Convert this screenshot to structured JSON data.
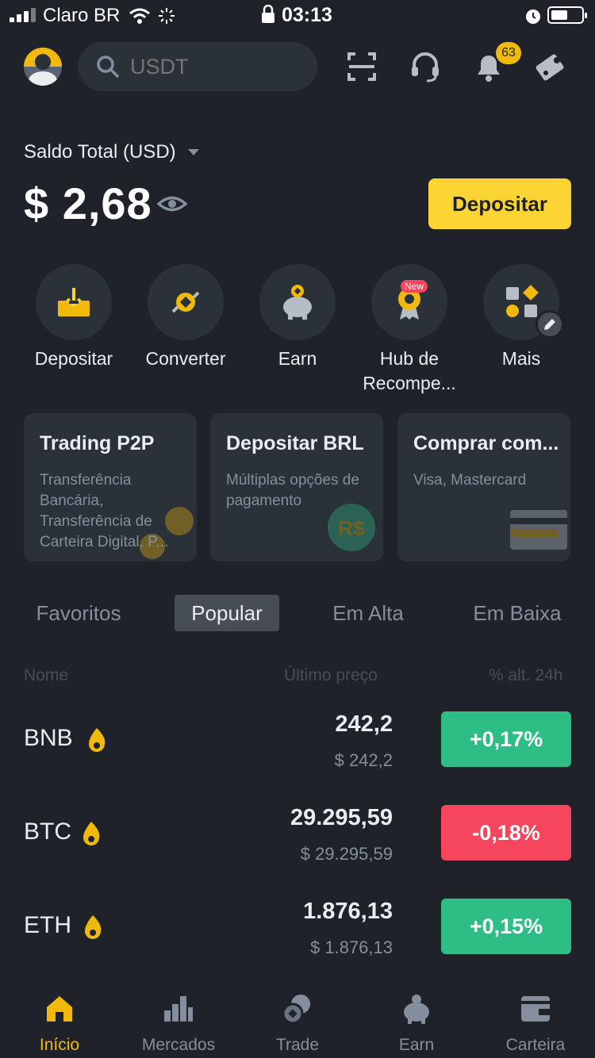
{
  "status_bar": {
    "carrier": "Claro BR",
    "time": "03:13"
  },
  "header": {
    "search_placeholder": "USDT",
    "notification_count": "63"
  },
  "balance": {
    "label": "Saldo Total (USD)",
    "value": "$ 2,68",
    "deposit_label": "Depositar"
  },
  "quick_actions": [
    {
      "label": "Depositar",
      "icon": "deposit-icon"
    },
    {
      "label": "Converter",
      "icon": "convert-icon"
    },
    {
      "label": "Earn",
      "icon": "piggy-bank-icon"
    },
    {
      "label": "Hub de Recompe...",
      "icon": "reward-medal-icon",
      "tag": "New"
    },
    {
      "label": "Mais",
      "icon": "more-apps-icon"
    }
  ],
  "promo_cards": [
    {
      "title": "Trading P2P",
      "subtitle": "Transferência Bancária, Transferência de Carteira Digital, P..."
    },
    {
      "title": "Depositar BRL",
      "subtitle": "Múltiplas opções de pagamento"
    },
    {
      "title": "Comprar com...",
      "subtitle": "Visa, Mastercard"
    }
  ],
  "market_tabs": [
    {
      "label": "Favoritos"
    },
    {
      "label": "Popular"
    },
    {
      "label": "Em Alta"
    },
    {
      "label": "Em Baixa"
    }
  ],
  "market_table": {
    "headers": {
      "name": "Nome",
      "price": "Último preço",
      "change": "% alt. 24h"
    },
    "rows": [
      {
        "coin": "BNB",
        "price": "242,2",
        "fiat": "$ 242,2",
        "change": "+0,17%",
        "direction": "up"
      },
      {
        "coin": "BTC",
        "price": "29.295,59",
        "fiat": "$ 29.295,59",
        "change": "-0,18%",
        "direction": "down"
      },
      {
        "coin": "ETH",
        "price": "1.876,13",
        "fiat": "$ 1.876,13",
        "change": "+0,15%",
        "direction": "up"
      }
    ]
  },
  "bottom_nav": [
    {
      "label": "Início",
      "icon": "home-icon",
      "active": true
    },
    {
      "label": "Mercados",
      "icon": "bar-chart-icon"
    },
    {
      "label": "Trade",
      "icon": "trade-coins-icon"
    },
    {
      "label": "Earn",
      "icon": "piggy-bank-icon"
    },
    {
      "label": "Carteira",
      "icon": "wallet-icon"
    }
  ],
  "colors": {
    "background": "#1f2329",
    "surface": "#2b3139",
    "accent": "#f0b90b",
    "button": "#fcd535",
    "positive": "#2ebd85",
    "negative": "#f6465d",
    "muted": "#848e9c"
  }
}
